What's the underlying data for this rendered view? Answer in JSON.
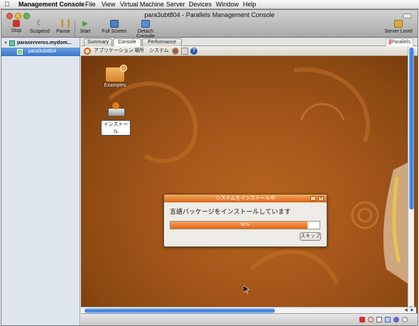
{
  "menubar": {
    "app_name": "Management Console",
    "items": [
      "File",
      "View",
      "Virtual Machine",
      "Server",
      "Devices",
      "Window",
      "Help"
    ]
  },
  "window": {
    "title": "para3ubt804 - Parallels Management Console"
  },
  "toolbar": {
    "stop": "Stop",
    "suspend": "Suspend",
    "pause": "Pause",
    "start": "Start",
    "full_screen": "Full Screen",
    "detach_console": "Detach Console",
    "server_level": "Server Level"
  },
  "sidebar": {
    "server": "paraserveros.mydom...",
    "vm": "para3ubt804"
  },
  "tabs": {
    "summary": "Summary",
    "console": "Console",
    "performance": "Performance",
    "logo": "Parallels"
  },
  "guest": {
    "panel_menus": [
      "アプリケーション",
      "場所",
      "システム"
    ],
    "icons": {
      "examples": "Examples",
      "install": "インストール"
    },
    "dialog": {
      "title": "システムをインストール中",
      "message": "言語パッケージをインストールしています",
      "progress": 0.92,
      "progress_label": "92%",
      "skip_button": "スキップ"
    }
  },
  "colors": {
    "accent": "#2b76d8",
    "desktop": "#a5561a",
    "dialog_titlebar": "#e06a20"
  }
}
